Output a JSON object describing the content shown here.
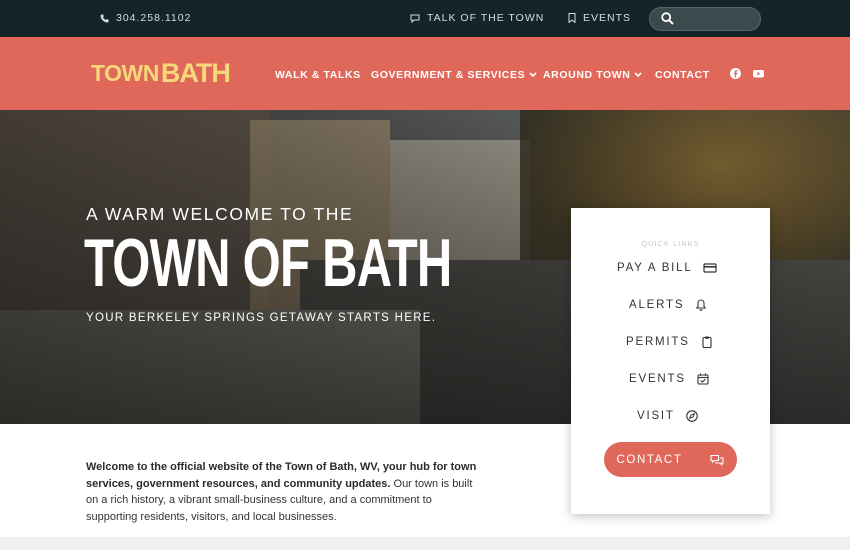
{
  "topbar": {
    "phone": "304.258.1102",
    "talk": "TALK OF THE TOWN",
    "events": "EVENTS",
    "search_placeholder": ""
  },
  "header": {
    "logo_top": "TOWN",
    "logo_main": "BATH",
    "nav": [
      "WALK & TALKS",
      "GOVERNMENT & SERVICES",
      "AROUND TOWN",
      "CONTACT"
    ],
    "social": [
      "facebook-icon",
      "youtube-icon"
    ]
  },
  "hero": {
    "kicker": "A WARM WELCOME TO THE",
    "title": "TOWN OF BATH",
    "subtitle": "YOUR BERKELEY SPRINGS GETAWAY STARTS HERE."
  },
  "quick_links": {
    "title": "QUICK LINKS",
    "items": [
      {
        "label": "PAY A BILL",
        "icon": "credit-card-icon"
      },
      {
        "label": "ALERTS",
        "icon": "bell-icon"
      },
      {
        "label": "PERMITS",
        "icon": "clipboard-icon"
      },
      {
        "label": "EVENTS",
        "icon": "calendar-check-icon"
      },
      {
        "label": "VISIT",
        "icon": "compass-icon"
      }
    ],
    "contact": "CONTACT"
  },
  "intro": {
    "bold": "Welcome to the official website of the Town of Bath, WV, your hub for town services, government resources, and community updates.",
    "rest": " Our town is built on a rich history, a vibrant small-business culture, and a commitment to supporting residents, visitors, and local businesses."
  },
  "colors": {
    "accent": "#e0685a",
    "topbar": "#132528",
    "logo": "#f6d77a"
  }
}
